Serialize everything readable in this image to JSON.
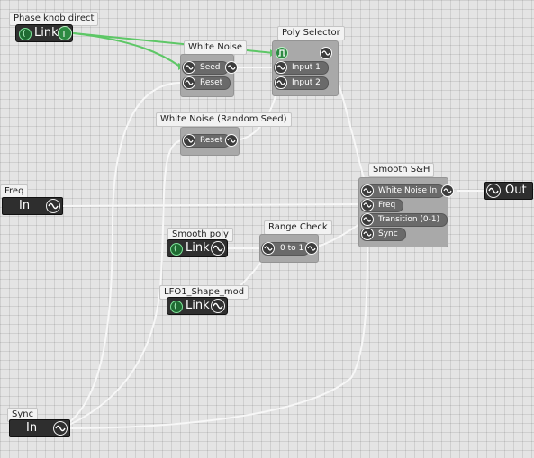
{
  "colors": {
    "canvas": "#e4e4e4",
    "grid": "#cfcfcf",
    "module": "#a9a9a9",
    "pill": "#6a6a6a",
    "wire_white": "#f7f7f7",
    "wire_green": "#5dc766"
  },
  "nodes": {
    "phase_knob": {
      "title": "Phase knob direct",
      "label": "Link"
    },
    "white_noise": {
      "title": "White Noise",
      "seed": "Seed",
      "reset": "Reset"
    },
    "poly_selector": {
      "title": "Poly Selector",
      "input1": "Input 1",
      "input2": "Input 2"
    },
    "white_noise_random": {
      "title": "White Noise (Random Seed)",
      "reset": "Reset"
    },
    "freq": {
      "title": "Freq",
      "label": "In"
    },
    "smooth_sh": {
      "title": "Smooth S&H",
      "white_noise_in": "White Noise In",
      "freq": "Freq",
      "transition": "Transition (0-1)",
      "sync": "Sync"
    },
    "out": {
      "label": "Out"
    },
    "smooth_poly": {
      "title": "Smooth poly",
      "label": "Link"
    },
    "range_check": {
      "title": "Range Check",
      "range": "0 to 1"
    },
    "lfo_shape": {
      "title": "LFO1_Shape_mod",
      "label": "Link"
    },
    "sync": {
      "title": "Sync",
      "label": "In"
    }
  },
  "icons": {
    "wave": "sine-wave-icon",
    "pulse": "pulse-icon",
    "link": "link-icon",
    "info": "info-icon"
  }
}
